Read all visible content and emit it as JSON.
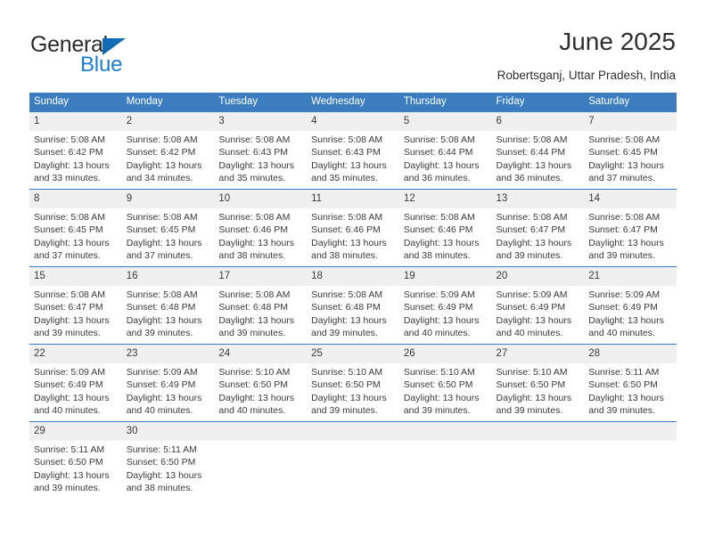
{
  "brand": {
    "name_part1": "General",
    "name_part2": "Blue",
    "triangle_color": "#0f6cb5",
    "blue_color": "#1b7fd4"
  },
  "header": {
    "title": "June 2025",
    "subtitle": "Robertsganj, Uttar Pradesh, India"
  },
  "theme": {
    "header_bg": "#3b7dbf",
    "daynum_bg": "#f0f0f0",
    "text_color": "#3a3a3a"
  },
  "weekdays": [
    "Sunday",
    "Monday",
    "Tuesday",
    "Wednesday",
    "Thursday",
    "Friday",
    "Saturday"
  ],
  "weeks": [
    [
      {
        "day": "1",
        "sunrise": "Sunrise: 5:08 AM",
        "sunset": "Sunset: 6:42 PM",
        "daylight_line1": "Daylight: 13 hours",
        "daylight_line2": "and 33 minutes."
      },
      {
        "day": "2",
        "sunrise": "Sunrise: 5:08 AM",
        "sunset": "Sunset: 6:42 PM",
        "daylight_line1": "Daylight: 13 hours",
        "daylight_line2": "and 34 minutes."
      },
      {
        "day": "3",
        "sunrise": "Sunrise: 5:08 AM",
        "sunset": "Sunset: 6:43 PM",
        "daylight_line1": "Daylight: 13 hours",
        "daylight_line2": "and 35 minutes."
      },
      {
        "day": "4",
        "sunrise": "Sunrise: 5:08 AM",
        "sunset": "Sunset: 6:43 PM",
        "daylight_line1": "Daylight: 13 hours",
        "daylight_line2": "and 35 minutes."
      },
      {
        "day": "5",
        "sunrise": "Sunrise: 5:08 AM",
        "sunset": "Sunset: 6:44 PM",
        "daylight_line1": "Daylight: 13 hours",
        "daylight_line2": "and 36 minutes."
      },
      {
        "day": "6",
        "sunrise": "Sunrise: 5:08 AM",
        "sunset": "Sunset: 6:44 PM",
        "daylight_line1": "Daylight: 13 hours",
        "daylight_line2": "and 36 minutes."
      },
      {
        "day": "7",
        "sunrise": "Sunrise: 5:08 AM",
        "sunset": "Sunset: 6:45 PM",
        "daylight_line1": "Daylight: 13 hours",
        "daylight_line2": "and 37 minutes."
      }
    ],
    [
      {
        "day": "8",
        "sunrise": "Sunrise: 5:08 AM",
        "sunset": "Sunset: 6:45 PM",
        "daylight_line1": "Daylight: 13 hours",
        "daylight_line2": "and 37 minutes."
      },
      {
        "day": "9",
        "sunrise": "Sunrise: 5:08 AM",
        "sunset": "Sunset: 6:45 PM",
        "daylight_line1": "Daylight: 13 hours",
        "daylight_line2": "and 37 minutes."
      },
      {
        "day": "10",
        "sunrise": "Sunrise: 5:08 AM",
        "sunset": "Sunset: 6:46 PM",
        "daylight_line1": "Daylight: 13 hours",
        "daylight_line2": "and 38 minutes."
      },
      {
        "day": "11",
        "sunrise": "Sunrise: 5:08 AM",
        "sunset": "Sunset: 6:46 PM",
        "daylight_line1": "Daylight: 13 hours",
        "daylight_line2": "and 38 minutes."
      },
      {
        "day": "12",
        "sunrise": "Sunrise: 5:08 AM",
        "sunset": "Sunset: 6:46 PM",
        "daylight_line1": "Daylight: 13 hours",
        "daylight_line2": "and 38 minutes."
      },
      {
        "day": "13",
        "sunrise": "Sunrise: 5:08 AM",
        "sunset": "Sunset: 6:47 PM",
        "daylight_line1": "Daylight: 13 hours",
        "daylight_line2": "and 39 minutes."
      },
      {
        "day": "14",
        "sunrise": "Sunrise: 5:08 AM",
        "sunset": "Sunset: 6:47 PM",
        "daylight_line1": "Daylight: 13 hours",
        "daylight_line2": "and 39 minutes."
      }
    ],
    [
      {
        "day": "15",
        "sunrise": "Sunrise: 5:08 AM",
        "sunset": "Sunset: 6:47 PM",
        "daylight_line1": "Daylight: 13 hours",
        "daylight_line2": "and 39 minutes."
      },
      {
        "day": "16",
        "sunrise": "Sunrise: 5:08 AM",
        "sunset": "Sunset: 6:48 PM",
        "daylight_line1": "Daylight: 13 hours",
        "daylight_line2": "and 39 minutes."
      },
      {
        "day": "17",
        "sunrise": "Sunrise: 5:08 AM",
        "sunset": "Sunset: 6:48 PM",
        "daylight_line1": "Daylight: 13 hours",
        "daylight_line2": "and 39 minutes."
      },
      {
        "day": "18",
        "sunrise": "Sunrise: 5:08 AM",
        "sunset": "Sunset: 6:48 PM",
        "daylight_line1": "Daylight: 13 hours",
        "daylight_line2": "and 39 minutes."
      },
      {
        "day": "19",
        "sunrise": "Sunrise: 5:09 AM",
        "sunset": "Sunset: 6:49 PM",
        "daylight_line1": "Daylight: 13 hours",
        "daylight_line2": "and 40 minutes."
      },
      {
        "day": "20",
        "sunrise": "Sunrise: 5:09 AM",
        "sunset": "Sunset: 6:49 PM",
        "daylight_line1": "Daylight: 13 hours",
        "daylight_line2": "and 40 minutes."
      },
      {
        "day": "21",
        "sunrise": "Sunrise: 5:09 AM",
        "sunset": "Sunset: 6:49 PM",
        "daylight_line1": "Daylight: 13 hours",
        "daylight_line2": "and 40 minutes."
      }
    ],
    [
      {
        "day": "22",
        "sunrise": "Sunrise: 5:09 AM",
        "sunset": "Sunset: 6:49 PM",
        "daylight_line1": "Daylight: 13 hours",
        "daylight_line2": "and 40 minutes."
      },
      {
        "day": "23",
        "sunrise": "Sunrise: 5:09 AM",
        "sunset": "Sunset: 6:49 PM",
        "daylight_line1": "Daylight: 13 hours",
        "daylight_line2": "and 40 minutes."
      },
      {
        "day": "24",
        "sunrise": "Sunrise: 5:10 AM",
        "sunset": "Sunset: 6:50 PM",
        "daylight_line1": "Daylight: 13 hours",
        "daylight_line2": "and 40 minutes."
      },
      {
        "day": "25",
        "sunrise": "Sunrise: 5:10 AM",
        "sunset": "Sunset: 6:50 PM",
        "daylight_line1": "Daylight: 13 hours",
        "daylight_line2": "and 39 minutes."
      },
      {
        "day": "26",
        "sunrise": "Sunrise: 5:10 AM",
        "sunset": "Sunset: 6:50 PM",
        "daylight_line1": "Daylight: 13 hours",
        "daylight_line2": "and 39 minutes."
      },
      {
        "day": "27",
        "sunrise": "Sunrise: 5:10 AM",
        "sunset": "Sunset: 6:50 PM",
        "daylight_line1": "Daylight: 13 hours",
        "daylight_line2": "and 39 minutes."
      },
      {
        "day": "28",
        "sunrise": "Sunrise: 5:11 AM",
        "sunset": "Sunset: 6:50 PM",
        "daylight_line1": "Daylight: 13 hours",
        "daylight_line2": "and 39 minutes."
      }
    ],
    [
      {
        "day": "29",
        "sunrise": "Sunrise: 5:11 AM",
        "sunset": "Sunset: 6:50 PM",
        "daylight_line1": "Daylight: 13 hours",
        "daylight_line2": "and 39 minutes."
      },
      {
        "day": "30",
        "sunrise": "Sunrise: 5:11 AM",
        "sunset": "Sunset: 6:50 PM",
        "daylight_line1": "Daylight: 13 hours",
        "daylight_line2": "and 38 minutes."
      },
      {
        "day": "",
        "sunrise": "",
        "sunset": "",
        "daylight_line1": "",
        "daylight_line2": ""
      },
      {
        "day": "",
        "sunrise": "",
        "sunset": "",
        "daylight_line1": "",
        "daylight_line2": ""
      },
      {
        "day": "",
        "sunrise": "",
        "sunset": "",
        "daylight_line1": "",
        "daylight_line2": ""
      },
      {
        "day": "",
        "sunrise": "",
        "sunset": "",
        "daylight_line1": "",
        "daylight_line2": ""
      },
      {
        "day": "",
        "sunrise": "",
        "sunset": "",
        "daylight_line1": "",
        "daylight_line2": ""
      }
    ]
  ]
}
